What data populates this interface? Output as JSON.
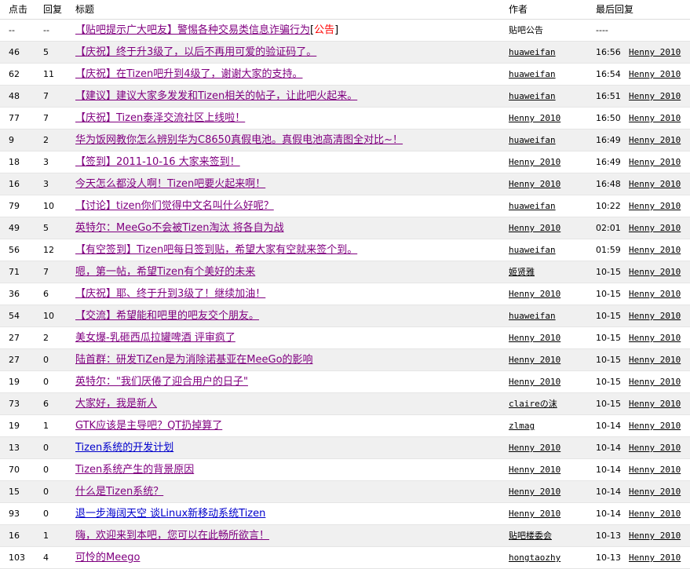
{
  "header": {
    "clicks": "点击",
    "replies": "回复",
    "title": "标题",
    "author": "作者",
    "last_reply": "最后回复"
  },
  "notice": {
    "clicks": "--",
    "replies": "--",
    "title": "【贴吧提示广大吧友】警惕各种交易类信息诈骗行为",
    "bracket_open": "[",
    "tag": "公告",
    "bracket_close": "]",
    "author": "贴吧公告",
    "last": "----"
  },
  "colors": {
    "visited_link": "#800080",
    "unvisited_link": "#0000cc",
    "notice_tag": "#ff0000",
    "alt_row": "#f0f0f0"
  },
  "rows": [
    {
      "clicks": "46",
      "replies": "5",
      "title": "【庆祝】终于升3级了，以后不再用可爱的验证码了。",
      "visited": true,
      "author": "huaweifan",
      "time": "16:56",
      "last_user": "Henny 2010"
    },
    {
      "clicks": "62",
      "replies": "11",
      "title": "【庆祝】在Tizen吧升到4级了，谢谢大家的支持。",
      "visited": true,
      "author": "huaweifan",
      "time": "16:54",
      "last_user": "Henny 2010"
    },
    {
      "clicks": "48",
      "replies": "7",
      "title": "【建议】建议大家多发发和Tizen相关的帖子，让此吧火起来。",
      "visited": true,
      "author": "huaweifan",
      "time": "16:51",
      "last_user": "Henny 2010"
    },
    {
      "clicks": "77",
      "replies": "7",
      "title": "【庆祝】Tizen泰泽交流社区上线啦！",
      "visited": true,
      "author": "Henny 2010",
      "time": "16:50",
      "last_user": "Henny 2010"
    },
    {
      "clicks": "9",
      "replies": "2",
      "title": "华为饭网教你怎么辨别华为C8650真假电池。真假电池高清图全对比~！",
      "visited": true,
      "author": "huaweifan",
      "time": "16:49",
      "last_user": "Henny 2010"
    },
    {
      "clicks": "18",
      "replies": "3",
      "title": "【签到】2011-10-16 大家来签到！",
      "visited": true,
      "author": "Henny 2010",
      "time": "16:49",
      "last_user": "Henny 2010"
    },
    {
      "clicks": "16",
      "replies": "3",
      "title": "今天怎么都没人啊！Tizen吧要火起来啊！",
      "visited": true,
      "author": "Henny 2010",
      "time": "16:48",
      "last_user": "Henny 2010"
    },
    {
      "clicks": "79",
      "replies": "10",
      "title": "【讨论】tizen你们觉得中文名叫什么好呢？",
      "visited": true,
      "author": "huaweifan",
      "time": "10:22",
      "last_user": "Henny 2010"
    },
    {
      "clicks": "49",
      "replies": "5",
      "title": "英特尔：MeeGo不会被Tizen淘汰 将各自为战",
      "visited": true,
      "author": "Henny 2010",
      "time": "02:01",
      "last_user": "Henny 2010"
    },
    {
      "clicks": "56",
      "replies": "12",
      "title": "【有空签到】Tizen吧每日签到贴，希望大家有空就来签个到。",
      "visited": true,
      "author": "huaweifan",
      "time": "01:59",
      "last_user": "Henny 2010"
    },
    {
      "clicks": "71",
      "replies": "7",
      "title": "嗯，第一帖，希望Tizen有个美好的未来",
      "visited": true,
      "author": "姬贤雅",
      "time": "10-15",
      "last_user": "Henny 2010"
    },
    {
      "clicks": "36",
      "replies": "6",
      "title": "【庆祝】耶、终于升到3级了！继续加油！",
      "visited": true,
      "author": "Henny 2010",
      "time": "10-15",
      "last_user": "Henny 2010"
    },
    {
      "clicks": "54",
      "replies": "10",
      "title": "【交流】希望能和吧里的吧友交个朋友。",
      "visited": true,
      "author": "huaweifan",
      "time": "10-15",
      "last_user": "Henny 2010"
    },
    {
      "clicks": "27",
      "replies": "2",
      "title": "美女爆-乳砸西瓜拉罐啤酒 评审疯了",
      "visited": true,
      "author": "Henny 2010",
      "time": "10-15",
      "last_user": "Henny 2010"
    },
    {
      "clicks": "27",
      "replies": "0",
      "title": "陆首群：研发TiZen是为消除诺基亚在MeeGo的影响",
      "visited": true,
      "author": "Henny 2010",
      "time": "10-15",
      "last_user": "Henny 2010"
    },
    {
      "clicks": "19",
      "replies": "0",
      "title": "英特尔：\"我们厌倦了迎合用户的日子\"",
      "visited": true,
      "author": "Henny 2010",
      "time": "10-15",
      "last_user": "Henny 2010"
    },
    {
      "clicks": "73",
      "replies": "6",
      "title": "大家好，我是新人",
      "visited": true,
      "author": "claireの沫",
      "time": "10-15",
      "last_user": "Henny 2010"
    },
    {
      "clicks": "19",
      "replies": "1",
      "title": "GTK应该是主导吧？QT扔掉算了",
      "visited": true,
      "author": "zlmag",
      "time": "10-14",
      "last_user": "Henny 2010"
    },
    {
      "clicks": "13",
      "replies": "0",
      "title": "Tizen系统的开发计划",
      "visited": false,
      "author": "Henny 2010",
      "time": "10-14",
      "last_user": "Henny 2010"
    },
    {
      "clicks": "70",
      "replies": "0",
      "title": "Tizen系统产生的背景原因",
      "visited": true,
      "author": "Henny 2010",
      "time": "10-14",
      "last_user": "Henny 2010"
    },
    {
      "clicks": "15",
      "replies": "0",
      "title": "什么是Tizen系统？",
      "visited": true,
      "author": "Henny 2010",
      "time": "10-14",
      "last_user": "Henny 2010"
    },
    {
      "clicks": "93",
      "replies": "0",
      "title": "退一步海阔天空 谈Linux新移动系统Tizen",
      "visited": false,
      "author": "Henny 2010",
      "time": "10-14",
      "last_user": "Henny 2010"
    },
    {
      "clicks": "16",
      "replies": "1",
      "title": "嗨，欢迎来到本吧，您可以在此畅所欲言！",
      "visited": true,
      "author": "贴吧楼委会",
      "time": "10-13",
      "last_user": "Henny 2010"
    },
    {
      "clicks": "103",
      "replies": "4",
      "title": "可怜的Meego",
      "visited": true,
      "author": "hongtaozhy",
      "time": "10-13",
      "last_user": "Henny 2010"
    }
  ]
}
